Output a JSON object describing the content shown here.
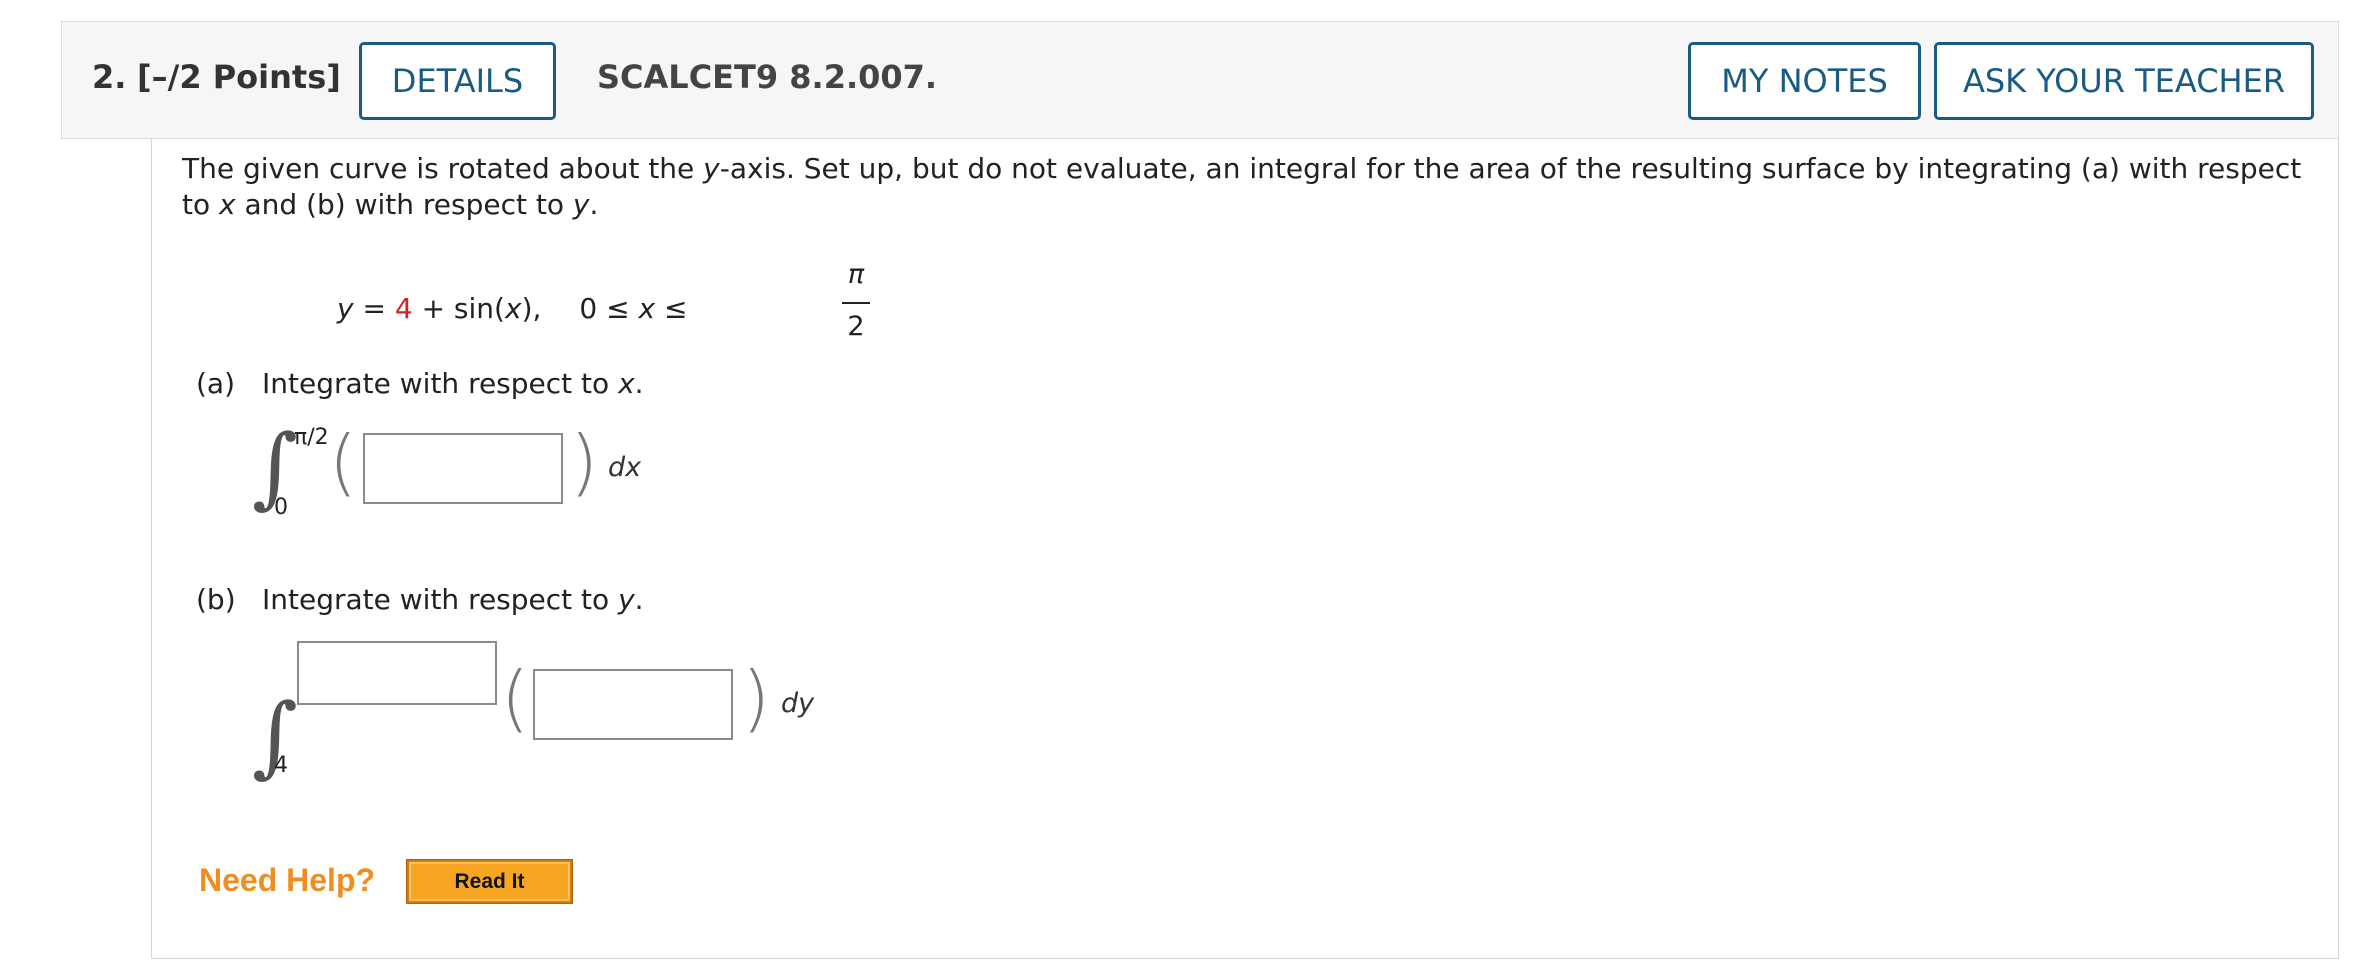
{
  "header": {
    "question_number": "2.",
    "points": "[–/2 Points]",
    "details_label": "DETAILS",
    "question_id": "SCALCET9 8.2.007.",
    "my_notes_label": "MY NOTES",
    "ask_teacher_label": "ASK YOUR TEACHER"
  },
  "prompt": {
    "p1": "The given curve is rotated about the ",
    "v1": "y",
    "p2": "-axis. Set up, but do not evaluate, an integral for the area of the resulting surface by integrating (a) with respect to ",
    "v2": "x",
    "p3": " and (b) with respect to ",
    "v3": "y",
    "p4": "."
  },
  "equation": {
    "y": "y",
    "eq": " = ",
    "const": "4",
    "rest": " + sin(",
    "x1": "x",
    "close": "),",
    "range_start": "0 ≤ ",
    "x2": "x",
    "le": " ≤",
    "frac_num": "π",
    "frac_den": "2"
  },
  "part_a": {
    "letter": "(a)",
    "text": "Integrate with respect to ",
    "var": "x",
    "dot": ".",
    "upper_limit": "π/2",
    "lower_limit": "0",
    "answer_value": "",
    "differential": "dx"
  },
  "part_b": {
    "letter": "(b)",
    "text": "Integrate with respect to ",
    "var": "y",
    "dot": ".",
    "upper_limit_value": "",
    "lower_limit": "4",
    "answer_value": "",
    "differential": "dy"
  },
  "help": {
    "label": "Need Help?",
    "read_it_label": "Read It"
  },
  "colors": {
    "accent": "#1a5b84",
    "red_value": "#d42020",
    "help_orange": "#ef8d20",
    "read_it_bg": "#f7a624"
  }
}
